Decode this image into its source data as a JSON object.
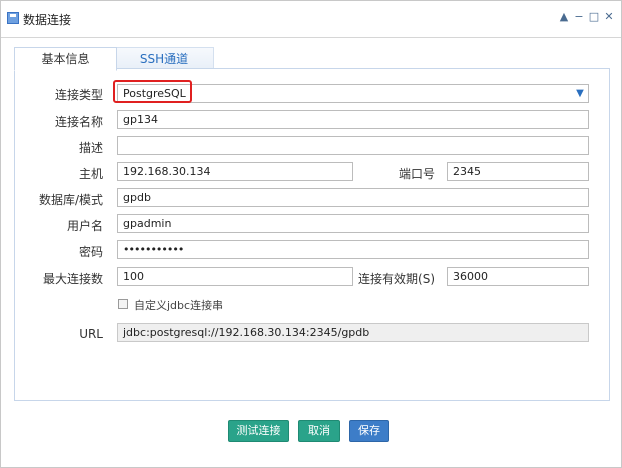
{
  "window": {
    "title": "数据连接",
    "controls": {
      "collapse": "▲",
      "minimize": "−",
      "maximize": "□",
      "close": "✕"
    }
  },
  "tabs": [
    {
      "label": "基本信息",
      "active": true
    },
    {
      "label": "SSH通道",
      "active": false
    }
  ],
  "form": {
    "type_label": "连接类型",
    "type_value": "PostgreSQL",
    "name_label": "连接名称",
    "name_value": "gp134",
    "desc_label": "描述",
    "desc_value": "",
    "host_label": "主机",
    "host_value": "192.168.30.134",
    "port_label": "端口号",
    "port_value": "2345",
    "db_label": "数据库/模式",
    "db_value": "gpdb",
    "user_label": "用户名",
    "user_value": "gpadmin",
    "pwd_label": "密码",
    "pwd_value": "•••••••••••",
    "maxconn_label": "最大连接数",
    "maxconn_value": "100",
    "validity_label": "连接有效期(S)",
    "validity_value": "36000",
    "jdbc_checkbox_label": "自定义jdbc连接串",
    "jdbc_checked": false,
    "url_label": "URL",
    "url_value": "jdbc:postgresql://192.168.30.134:2345/gpdb"
  },
  "buttons": {
    "test": "测试连接",
    "cancel": "取消",
    "save": "保存"
  },
  "colors": {
    "accent_blue": "#3d7dc8",
    "accent_green": "#2aa38a",
    "highlight": "#e02020"
  }
}
